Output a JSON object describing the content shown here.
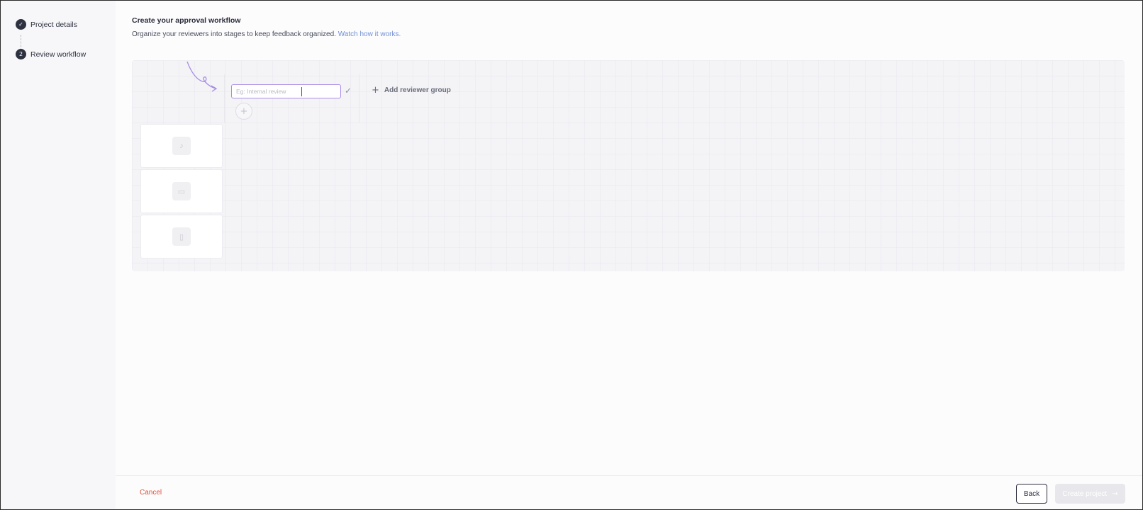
{
  "steps": [
    {
      "number": "✓",
      "label": "Project details",
      "state": "complete"
    },
    {
      "number": "2",
      "label": "Review workflow",
      "state": "current"
    }
  ],
  "header": {
    "title": "Create your approval workflow",
    "subtitle": "Organize your reviewers into stages to keep feedback organized.",
    "link": "Watch how it works."
  },
  "workflow": {
    "stage_input_placeholder": "Eg: Internal review",
    "add_group_label": "Add reviewer group",
    "media_types": [
      {
        "icon": "music-note-icon",
        "glyph": "♪"
      },
      {
        "icon": "video-camera-icon",
        "glyph": "▭"
      },
      {
        "icon": "document-icon",
        "glyph": "▯"
      }
    ]
  },
  "footer": {
    "cancel_label": "Cancel",
    "back_label": "Back",
    "create_label": "Create project"
  },
  "colors": {
    "accent": "#a98de6",
    "cancel": "#d9533d",
    "link": "#6f8fd6"
  }
}
